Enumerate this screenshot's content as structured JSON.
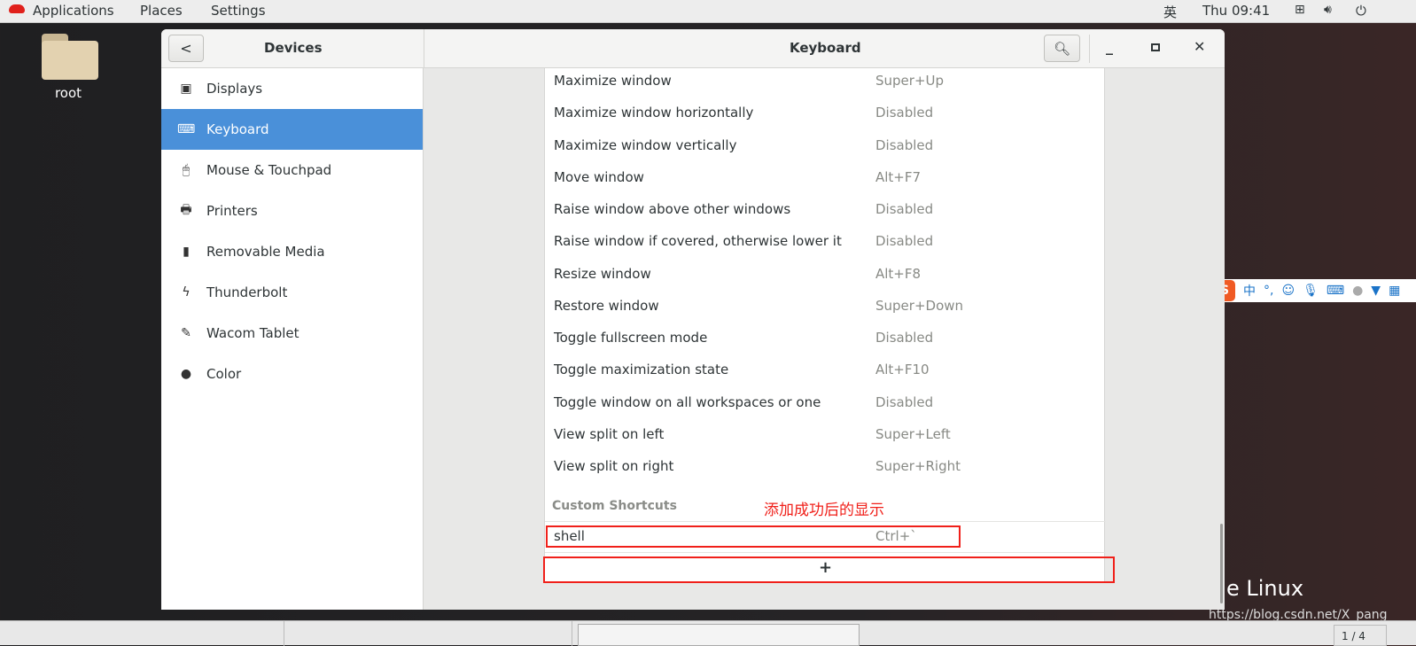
{
  "topbar": {
    "applications": "Applications",
    "places": "Places",
    "settings": "Settings",
    "input_method": "英",
    "clock": "Thu 09:41"
  },
  "desktop": {
    "home_icon_label": "root",
    "brand_text": "e Linux",
    "watermark": "https://blog.csdn.net/X_pang"
  },
  "window": {
    "sidebar_title": "Devices",
    "main_title": "Keyboard"
  },
  "sidebar": {
    "items": [
      {
        "label": "Displays",
        "icon": "display-icon"
      },
      {
        "label": "Keyboard",
        "icon": "keyboard-icon",
        "selected": true
      },
      {
        "label": "Mouse & Touchpad",
        "icon": "mouse-icon"
      },
      {
        "label": "Printers",
        "icon": "printer-icon"
      },
      {
        "label": "Removable Media",
        "icon": "media-icon"
      },
      {
        "label": "Thunderbolt",
        "icon": "thunderbolt-icon"
      },
      {
        "label": "Wacom Tablet",
        "icon": "tablet-icon"
      },
      {
        "label": "Color",
        "icon": "color-icon"
      }
    ]
  },
  "shortcuts": [
    {
      "name": "Maximize window",
      "key": "Super+Up"
    },
    {
      "name": "Maximize window horizontally",
      "key": "Disabled"
    },
    {
      "name": "Maximize window vertically",
      "key": "Disabled"
    },
    {
      "name": "Move window",
      "key": "Alt+F7"
    },
    {
      "name": "Raise window above other windows",
      "key": "Disabled"
    },
    {
      "name": "Raise window if covered, otherwise lower it",
      "key": "Disabled"
    },
    {
      "name": "Resize window",
      "key": "Alt+F8"
    },
    {
      "name": "Restore window",
      "key": "Super+Down"
    },
    {
      "name": "Toggle fullscreen mode",
      "key": "Disabled"
    },
    {
      "name": "Toggle maximization state",
      "key": "Alt+F10"
    },
    {
      "name": "Toggle window on all workspaces or one",
      "key": "Disabled"
    },
    {
      "name": "View split on left",
      "key": "Super+Left"
    },
    {
      "name": "View split on right",
      "key": "Super+Right"
    }
  ],
  "custom": {
    "header": "Custom Shortcuts",
    "items": [
      {
        "name": "shell",
        "key": "Ctrl+`"
      }
    ],
    "add_label": "+"
  },
  "annotation": {
    "text": "添加成功后的显示",
    "color": "#f0201a"
  },
  "ime": {
    "label": "中",
    "punct": "°,"
  },
  "taskbar": {
    "pager": "1 / 4"
  },
  "colors": {
    "accent": "#4a90d9"
  }
}
